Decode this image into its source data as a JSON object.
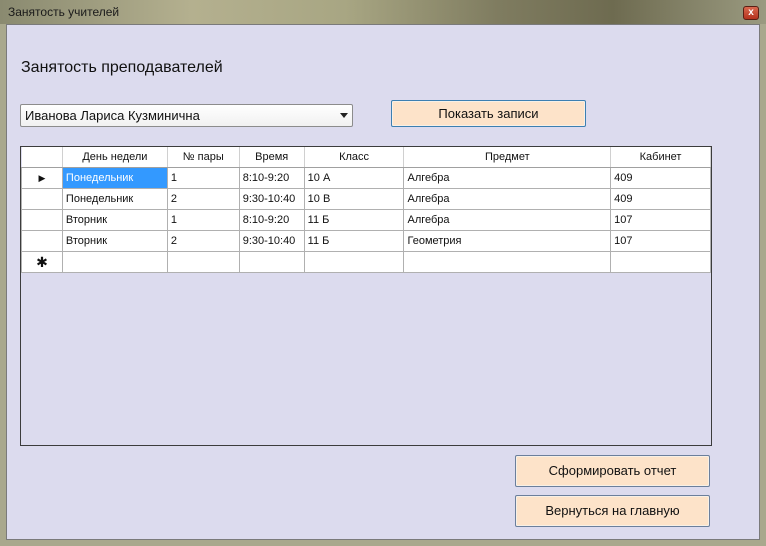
{
  "window": {
    "title": "Занятость учителей",
    "close_glyph": "x"
  },
  "main": {
    "heading": "Занятость преподавателей",
    "teacher_select": {
      "selected": "Иванова Лариса Кузминична"
    },
    "show_button": "Показать записи",
    "report_button": "Сформировать отчет",
    "back_button": "Вернуться на главную"
  },
  "grid": {
    "columns": [
      "День недели",
      "№ пары",
      "Время",
      "Класс",
      "Предмет",
      "Кабинет"
    ],
    "rows": [
      [
        "Понедельник",
        "1",
        "8:10-9:20",
        "10 А",
        "Алгебра",
        "409"
      ],
      [
        "Понедельник",
        "2",
        "9:30-10:40",
        "10 В",
        "Алгебра",
        "409"
      ],
      [
        "Вторник",
        "1",
        "8:10-9:20",
        "11 Б",
        "Алгебра",
        "107"
      ],
      [
        "Вторник",
        "2",
        "9:30-10:40",
        "11 Б",
        "Геометрия",
        "107"
      ]
    ],
    "current_row_glyph": "▶",
    "new_row_glyph": "✱"
  }
}
